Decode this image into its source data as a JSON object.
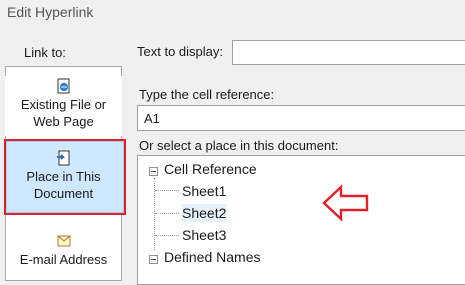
{
  "window": {
    "title": "Edit Hyperlink"
  },
  "link_to": {
    "label": "Link to:",
    "items": [
      {
        "label_line1": "Existing File or",
        "label_line2": "Web Page",
        "icon": "file-globe-icon"
      },
      {
        "label_line1": "Place in This",
        "label_line2": "Document",
        "icon": "document-place-icon",
        "selected": true
      },
      {
        "label_line1": "E-mail Address",
        "label_line2": "",
        "icon": "email-icon"
      }
    ]
  },
  "text_to_display": {
    "label": "Text to display:",
    "value": ""
  },
  "cell_reference": {
    "label": "Type the cell reference:",
    "value": "A1"
  },
  "place_in_document": {
    "label": "Or select a place in this document:",
    "tree": {
      "cell_reference": "Cell Reference",
      "sheets": [
        "Sheet1",
        "Sheet2",
        "Sheet3"
      ],
      "defined_names": "Defined Names"
    }
  },
  "colors": {
    "highlight": "#e0202a",
    "selection": "#cde8ff"
  }
}
